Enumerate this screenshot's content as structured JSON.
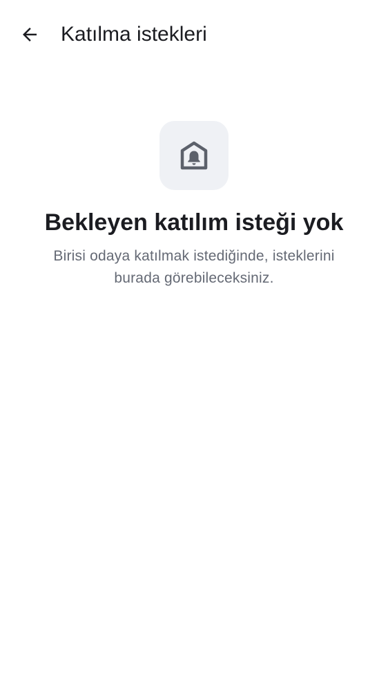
{
  "header": {
    "title": "Katılma istekleri",
    "back_icon": "arrow-left-icon"
  },
  "empty_state": {
    "icon": "home-bell-icon",
    "heading": "Bekleyen katılım isteği yok",
    "description": "Birisi odaya katılmak istediğinde, isteklerini burada görebileceksiniz."
  },
  "colors": {
    "background": "#ffffff",
    "text_primary": "#1b1c21",
    "text_secondary": "#646974",
    "icon_tile_bg": "#eff1f5",
    "icon_color": "#5c616b"
  }
}
